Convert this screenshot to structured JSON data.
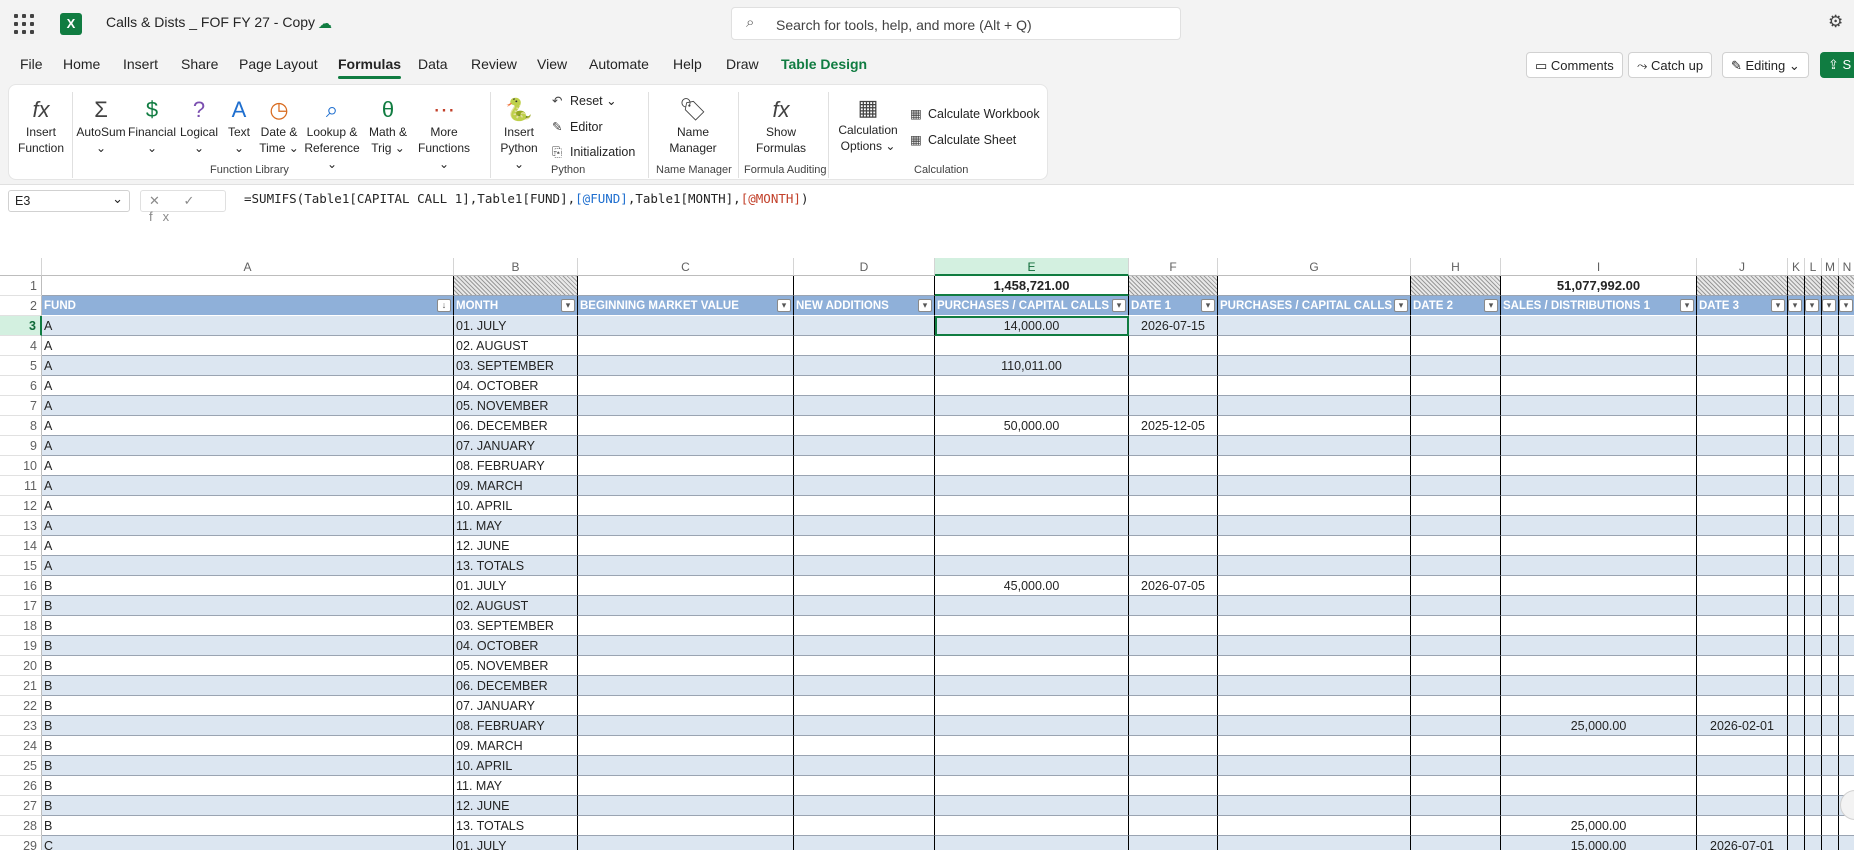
{
  "app": {
    "title": "Calls & Dists _ FOF FY 27 - Copy",
    "logo": "X",
    "search_placeholder": "Search for tools, help, and more (Alt + Q)"
  },
  "tabs": [
    "File",
    "Home",
    "Insert",
    "Share",
    "Page Layout",
    "Formulas",
    "Data",
    "Review",
    "View",
    "Automate",
    "Help",
    "Draw",
    "Table Design"
  ],
  "active_tab": "Formulas",
  "header_buttons": {
    "comments": "Comments",
    "catchup": "Catch up",
    "editing": "Editing",
    "share": "S"
  },
  "ribbon": {
    "insert_function": [
      "Insert",
      "Function"
    ],
    "autosum": "AutoSum",
    "financial": "Financial",
    "logical": "Logical",
    "text": "Text",
    "datetime": [
      "Date &",
      "Time"
    ],
    "lookup": [
      "Lookup &",
      "Reference"
    ],
    "mathtrig": [
      "Math &",
      "Trig"
    ],
    "more": [
      "More",
      "Functions"
    ],
    "group_library": "Function Library",
    "insert_python": [
      "Insert",
      "Python"
    ],
    "reset": "Reset",
    "editor": "Editor",
    "initialization": "Initialization",
    "group_python": "Python",
    "name_manager": [
      "Name",
      "Manager"
    ],
    "group_name": "Name Manager",
    "show_formulas": [
      "Show",
      "Formulas"
    ],
    "group_audit": "Formula Auditing",
    "calc_options": [
      "Calculation",
      "Options"
    ],
    "calc_workbook": "Calculate Workbook",
    "calc_sheet": "Calculate Sheet",
    "group_calc": "Calculation"
  },
  "formula_bar": {
    "namebox": "E3",
    "fx_controls": "✕ ✓ fx",
    "formula_parts": [
      "=SUMIFS(Table1[CAPITAL CALL 1],Table1[FUND],",
      "[@FUND]",
      ",Table1[MONTH],",
      "[@MONTH]",
      ")"
    ]
  },
  "columns": [
    "A",
    "B",
    "C",
    "D",
    "E",
    "F",
    "G",
    "H",
    "I",
    "J",
    "K",
    "L",
    "M",
    "N"
  ],
  "totals_row": {
    "E": "1,458,721.00",
    "I": "51,077,992.00"
  },
  "table_headers": [
    "FUND",
    "MONTH",
    "BEGINNING MARKET VALUE",
    "NEW ADDITIONS",
    "PURCHASES / CAPITAL CALLS 1",
    "DATE 1",
    "PURCHASES / CAPITAL CALLS 2",
    "DATE 2",
    "SALES / DISTRIBUTIONS 1",
    "DATE 3",
    "",
    "",
    "",
    ""
  ],
  "rows": [
    {
      "n": "3",
      "fund": "A",
      "month": "01. JULY",
      "e": "14,000.00",
      "f": "2026-07-15",
      "i": "",
      "j": ""
    },
    {
      "n": "4",
      "fund": "A",
      "month": "02. AUGUST",
      "e": "",
      "f": "",
      "i": "",
      "j": ""
    },
    {
      "n": "5",
      "fund": "A",
      "month": "03. SEPTEMBER",
      "e": "110,011.00",
      "f": "",
      "i": "",
      "j": ""
    },
    {
      "n": "6",
      "fund": "A",
      "month": "04. OCTOBER",
      "e": "",
      "f": "",
      "i": "",
      "j": ""
    },
    {
      "n": "7",
      "fund": "A",
      "month": "05. NOVEMBER",
      "e": "",
      "f": "",
      "i": "",
      "j": ""
    },
    {
      "n": "8",
      "fund": "A",
      "month": "06. DECEMBER",
      "e": "50,000.00",
      "f": "2025-12-05",
      "i": "",
      "j": ""
    },
    {
      "n": "9",
      "fund": "A",
      "month": "07. JANUARY",
      "e": "",
      "f": "",
      "i": "",
      "j": ""
    },
    {
      "n": "10",
      "fund": "A",
      "month": "08. FEBRUARY",
      "e": "",
      "f": "",
      "i": "",
      "j": ""
    },
    {
      "n": "11",
      "fund": "A",
      "month": "09. MARCH",
      "e": "",
      "f": "",
      "i": "",
      "j": ""
    },
    {
      "n": "12",
      "fund": "A",
      "month": "10. APRIL",
      "e": "",
      "f": "",
      "i": "",
      "j": ""
    },
    {
      "n": "13",
      "fund": "A",
      "month": "11. MAY",
      "e": "",
      "f": "",
      "i": "",
      "j": ""
    },
    {
      "n": "14",
      "fund": "A",
      "month": "12. JUNE",
      "e": "",
      "f": "",
      "i": "",
      "j": ""
    },
    {
      "n": "15",
      "fund": "A",
      "month": "13. TOTALS",
      "e": "",
      "f": "",
      "i": "",
      "j": ""
    },
    {
      "n": "16",
      "fund": "B",
      "month": "01. JULY",
      "e": "45,000.00",
      "f": "2026-07-05",
      "i": "",
      "j": ""
    },
    {
      "n": "17",
      "fund": "B",
      "month": "02. AUGUST",
      "e": "",
      "f": "",
      "i": "",
      "j": ""
    },
    {
      "n": "18",
      "fund": "B",
      "month": "03. SEPTEMBER",
      "e": "",
      "f": "",
      "i": "",
      "j": ""
    },
    {
      "n": "19",
      "fund": "B",
      "month": "04. OCTOBER",
      "e": "",
      "f": "",
      "i": "",
      "j": ""
    },
    {
      "n": "20",
      "fund": "B",
      "month": "05. NOVEMBER",
      "e": "",
      "f": "",
      "i": "",
      "j": ""
    },
    {
      "n": "21",
      "fund": "B",
      "month": "06. DECEMBER",
      "e": "",
      "f": "",
      "i": "",
      "j": ""
    },
    {
      "n": "22",
      "fund": "B",
      "month": "07. JANUARY",
      "e": "",
      "f": "",
      "i": "",
      "j": ""
    },
    {
      "n": "23",
      "fund": "B",
      "month": "08. FEBRUARY",
      "e": "",
      "f": "",
      "i": "25,000.00",
      "j": "2026-02-01"
    },
    {
      "n": "24",
      "fund": "B",
      "month": "09. MARCH",
      "e": "",
      "f": "",
      "i": "",
      "j": ""
    },
    {
      "n": "25",
      "fund": "B",
      "month": "10. APRIL",
      "e": "",
      "f": "",
      "i": "",
      "j": ""
    },
    {
      "n": "26",
      "fund": "B",
      "month": "11. MAY",
      "e": "",
      "f": "",
      "i": "",
      "j": ""
    },
    {
      "n": "27",
      "fund": "B",
      "month": "12. JUNE",
      "e": "",
      "f": "",
      "i": "",
      "j": ""
    },
    {
      "n": "28",
      "fund": "B",
      "month": "13. TOTALS",
      "e": "",
      "f": "",
      "i": "25,000.00",
      "j": ""
    },
    {
      "n": "29",
      "fund": "C",
      "month": "01. JULY",
      "e": "",
      "f": "",
      "i": "15,000.00",
      "j": "2026-07-01"
    }
  ],
  "colors": {
    "accent": "#107c41",
    "table_header": "#8fb0d9",
    "band": "#dce6f1"
  }
}
